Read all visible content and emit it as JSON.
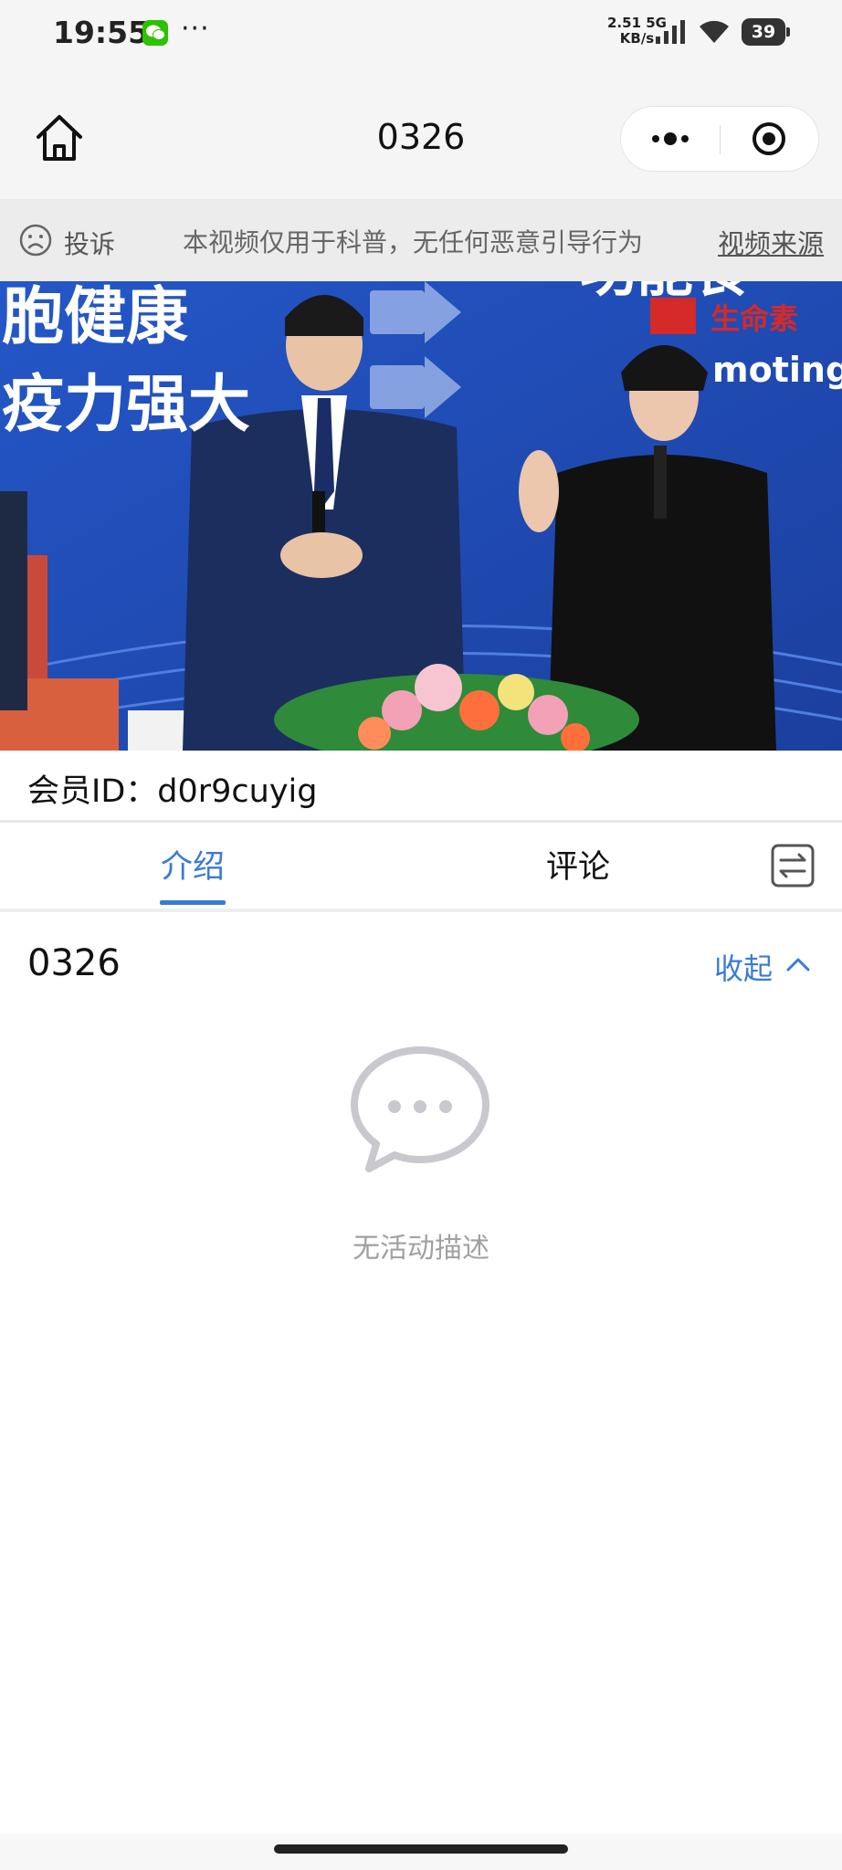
{
  "status_bar": {
    "time": "19:55",
    "app_icon": "wechat-icon",
    "more": "···",
    "network_speed_value": "2.51",
    "network_speed_unit": "KB/s",
    "network_type": "5G",
    "battery": "39"
  },
  "nav": {
    "title": "0326",
    "home_icon": "home-icon",
    "more_icon": "more-dots-icon",
    "close_icon": "close-target-icon"
  },
  "notice": {
    "complain_label": "投诉",
    "message": "本视频仅用于科普，无任何恶意引导行为",
    "source_link": "视频来源"
  },
  "video": {
    "banner_left_line1": "胞健康",
    "banner_left_line2": "疫力强大",
    "banner_right_top": "功能食",
    "banner_right_word": "moting",
    "brand": "生命素"
  },
  "member": {
    "id_text": "会员ID：d0r9cuyig"
  },
  "tabs": {
    "intro": "介绍",
    "comment": "评论"
  },
  "intro": {
    "title": "0326",
    "collapse": "收起",
    "empty_text": "无活动描述"
  },
  "colors": {
    "accent": "#3a7bd5",
    "nav_bg": "#f5f5f5",
    "notice_bg": "#ececec"
  }
}
